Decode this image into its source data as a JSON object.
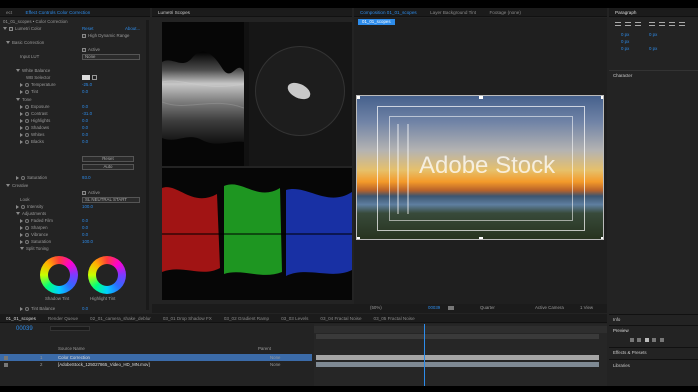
{
  "effect_controls": {
    "tabs": [
      "ect",
      "Effect Controls Color Correction"
    ],
    "comp_path": "01_01_scopes • Color Correction",
    "layer_name": "Lumetri Color",
    "reset": "Reset",
    "about": "About...",
    "hdr_label": "High Dynamic Range",
    "sections": {
      "basic": "Basic Correction",
      "input_lut": "Input LUT",
      "lut_value": "None",
      "white_balance": "White Balance",
      "wb_selector": "WB Selector",
      "temperature": "Temperature",
      "temperature_value": "-25.0",
      "tint": "Tint",
      "tint_value": "0.0",
      "tone": "Tone",
      "tone_items": [
        {
          "name": "Exposure",
          "value": "0.0"
        },
        {
          "name": "Contrast",
          "value": "-31.0"
        },
        {
          "name": "Highlights",
          "value": "0.0"
        },
        {
          "name": "Shadows",
          "value": "0.0"
        },
        {
          "name": "Whites",
          "value": "0.0"
        },
        {
          "name": "Blacks",
          "value": "0.0"
        }
      ],
      "reset_btn": "Reset",
      "auto_btn": "Auto",
      "saturation": "Saturation",
      "saturation_value": "93.0",
      "creative": "Creative",
      "active_label": "Active",
      "look": "Look",
      "look_value": "SL NEUTRAL START",
      "intensity": "Intensity",
      "intensity_value": "100.0",
      "adjustments": "Adjustments",
      "adj_items": [
        {
          "name": "Faded Film",
          "value": "0.0"
        },
        {
          "name": "Sharpen",
          "value": "0.0"
        },
        {
          "name": "Vibrance",
          "value": "0.0"
        },
        {
          "name": "Saturation",
          "value": "100.0"
        }
      ],
      "split_toning": "Split Toning",
      "shadow_tint": "Shadow Tint",
      "highlight_tint": "Highlight Tint",
      "tint_balance": "Tint Balance",
      "tint_balance_value": "0.0"
    }
  },
  "scopes": {
    "tab": "Lumetri Scopes",
    "clamp_signal": "Clamp Signal",
    "bit_depth": "8 Bit"
  },
  "composition": {
    "tabs": [
      {
        "label": "Composition 01_01_scopes",
        "active": true
      },
      {
        "label": "Layer Background Tint",
        "active": false
      },
      {
        "label": "Footage (none)",
        "active": false
      }
    ],
    "subtab": "01_01_scopes",
    "watermark": "Adobe Stock",
    "zoom": "(50%)",
    "timecode": "00039",
    "resolution": "Quarter",
    "camera": "Active Camera",
    "views": "1 View"
  },
  "paragraph": {
    "title": "Paragraph",
    "values": [
      "0 px",
      "0 px",
      "0 px",
      "0 px",
      "0 px"
    ],
    "character": "Character"
  },
  "right_bottom": {
    "info": "Info",
    "preview": "Preview",
    "effects_presets": "Effects & Presets",
    "libraries": "Libraries"
  },
  "timeline": {
    "tabs": [
      {
        "label": "01_01_scopes",
        "active": true
      },
      {
        "label": "Render Queue",
        "active": false
      },
      {
        "label": "02_01_camera_shake_deblur",
        "active": false
      },
      {
        "label": "03_01 Drop Shadow FX",
        "active": false
      },
      {
        "label": "03_02 Gradient Ramp",
        "active": false
      },
      {
        "label": "03_03 Levels",
        "active": false
      },
      {
        "label": "03_04 Fractal Noise",
        "active": false
      },
      {
        "label": "03_05 Fractal Noise",
        "active": false
      }
    ],
    "timecode": "00039",
    "col_source": "Source Name",
    "col_parent": "Parent",
    "layers": [
      {
        "num": "1",
        "name": "Color Correction",
        "parent": "None"
      },
      {
        "num": "2",
        "name": "[AdobeStock_125027865_Video_HD_MN.mov]",
        "parent": "None"
      }
    ]
  },
  "colors": {
    "accent": "#2d8ceb",
    "panel_bg": "#232323",
    "scope_bg": "#060606",
    "selection_blue": "#3b6ba9"
  }
}
